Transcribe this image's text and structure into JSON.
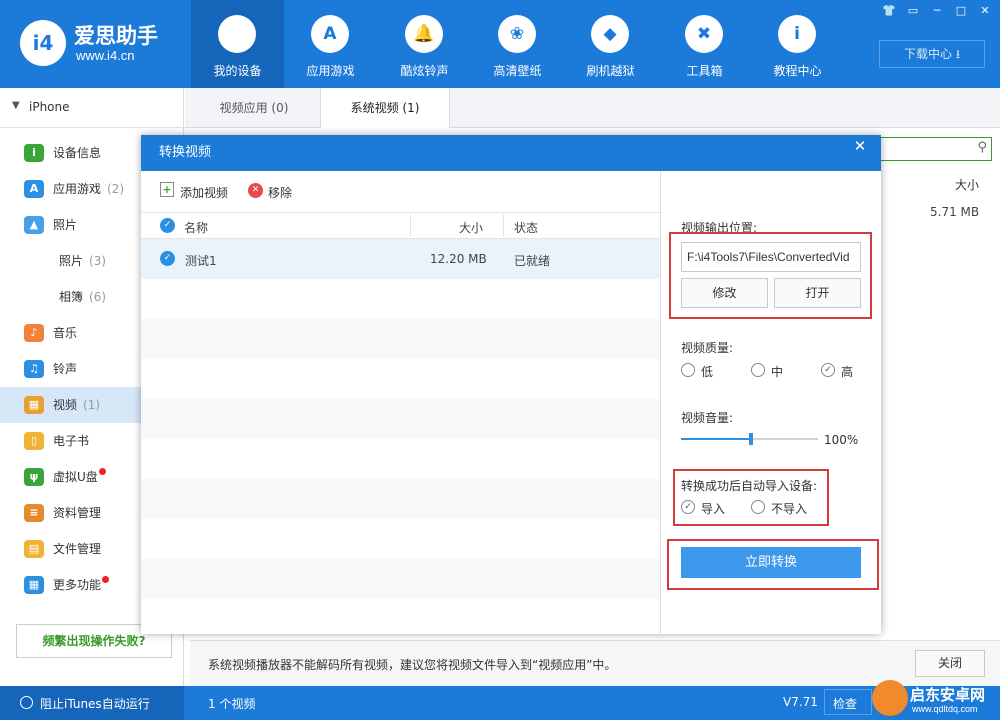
{
  "brand": {
    "name": "爱思助手",
    "url": "www.i4.cn",
    "logo": "i4"
  },
  "nav": [
    {
      "label": "我的设备",
      "icon": "apple-icon",
      "glyph": "",
      "active": true
    },
    {
      "label": "应用游戏",
      "icon": "app-store-icon",
      "glyph": "A"
    },
    {
      "label": "酷炫铃声",
      "icon": "bell-icon",
      "glyph": "🔔"
    },
    {
      "label": "高清壁纸",
      "icon": "flower-icon",
      "glyph": "❀"
    },
    {
      "label": "刷机越狱",
      "icon": "dropbox-icon",
      "glyph": "◆"
    },
    {
      "label": "工具箱",
      "icon": "tools-icon",
      "glyph": "✖"
    },
    {
      "label": "教程中心",
      "icon": "info-icon",
      "glyph": "i"
    }
  ],
  "window_controls": [
    "👕",
    "▭",
    "─",
    "□",
    "✕"
  ],
  "download_center": "下载中心",
  "device": "iPhone",
  "sidebar": [
    {
      "label": "设备信息",
      "count": "",
      "icon": "info-circle-icon",
      "color": "#3aa53a",
      "glyph": "i"
    },
    {
      "label": "应用游戏",
      "count": "(2)",
      "icon": "app-store-icon",
      "color": "#2d8fe0",
      "glyph": "A"
    },
    {
      "label": "照片",
      "count": "",
      "icon": "photo-icon",
      "color": "#4aa0e8",
      "glyph": "▲"
    },
    {
      "label": "照片",
      "count": "(3)",
      "icon": "",
      "color": "",
      "glyph": ""
    },
    {
      "label": "相簿",
      "count": "(6)",
      "icon": "",
      "color": "",
      "glyph": ""
    },
    {
      "label": "音乐",
      "count": "",
      "icon": "music-icon",
      "color": "#f0823a",
      "glyph": "♪"
    },
    {
      "label": "铃声",
      "count": "",
      "icon": "bell-icon",
      "color": "#2d8fe0",
      "glyph": "♫"
    },
    {
      "label": "视频",
      "count": "(1)",
      "icon": "video-icon",
      "color": "#e8a130",
      "glyph": "▦",
      "active": true
    },
    {
      "label": "电子书",
      "count": "",
      "icon": "book-icon",
      "color": "#f1b334",
      "glyph": "▯"
    },
    {
      "label": "虚拟U盘",
      "count": "",
      "icon": "usb-icon",
      "color": "#3aa53a",
      "glyph": "ψ",
      "dot": true
    },
    {
      "label": "资料管理",
      "count": "",
      "icon": "contacts-icon",
      "color": "#e58a2c",
      "glyph": "≡"
    },
    {
      "label": "文件管理",
      "count": "",
      "icon": "folder-icon",
      "color": "#f1b334",
      "glyph": "▤"
    },
    {
      "label": "更多功能",
      "count": "",
      "icon": "grid-icon",
      "color": "#2d8fe0",
      "glyph": "▦",
      "dot": true
    }
  ],
  "help_button": "频繁出现操作失败?",
  "tabs": [
    {
      "label": "视频应用 (0)",
      "active": false
    },
    {
      "label": "系统视频 (1)",
      "active": true
    }
  ],
  "list_header_size": "大小",
  "list_value_size": "5.71 MB",
  "notice": "系统视频播放器不能解码所有视频，建议您将视频文件导入到“视频应用”中。",
  "close_button": "关闭",
  "statusbar": {
    "itunes": "阻止iTunes自动运行",
    "count": "1 个视频",
    "version": "V7.71",
    "check": "检查"
  },
  "watermark": {
    "name": "启东安卓网",
    "url": "www.qdltdq.com"
  },
  "modal": {
    "title": "转换视频",
    "add_video": "添加视频",
    "remove": "移除",
    "columns": {
      "name": "名称",
      "size": "大小",
      "status": "状态"
    },
    "rows": [
      {
        "name": "测试1",
        "size": "12.20 MB",
        "status": "已就绪"
      }
    ],
    "output_label": "视频输出位置:",
    "output_path": "F:\\i4Tools7\\Files\\ConvertedVid",
    "modify_button": "修改",
    "open_button": "打开",
    "quality_label": "视频质量:",
    "quality_options": [
      "低",
      "中",
      "高"
    ],
    "quality_selected": "高",
    "volume_label": "视频音量:",
    "volume_value": "100%",
    "volume_level": 0.51,
    "auto_import_label": "转换成功后自动导入设备:",
    "import_options": [
      "导入",
      "不导入"
    ],
    "import_selected": "导入",
    "convert_button": "立即转换"
  }
}
